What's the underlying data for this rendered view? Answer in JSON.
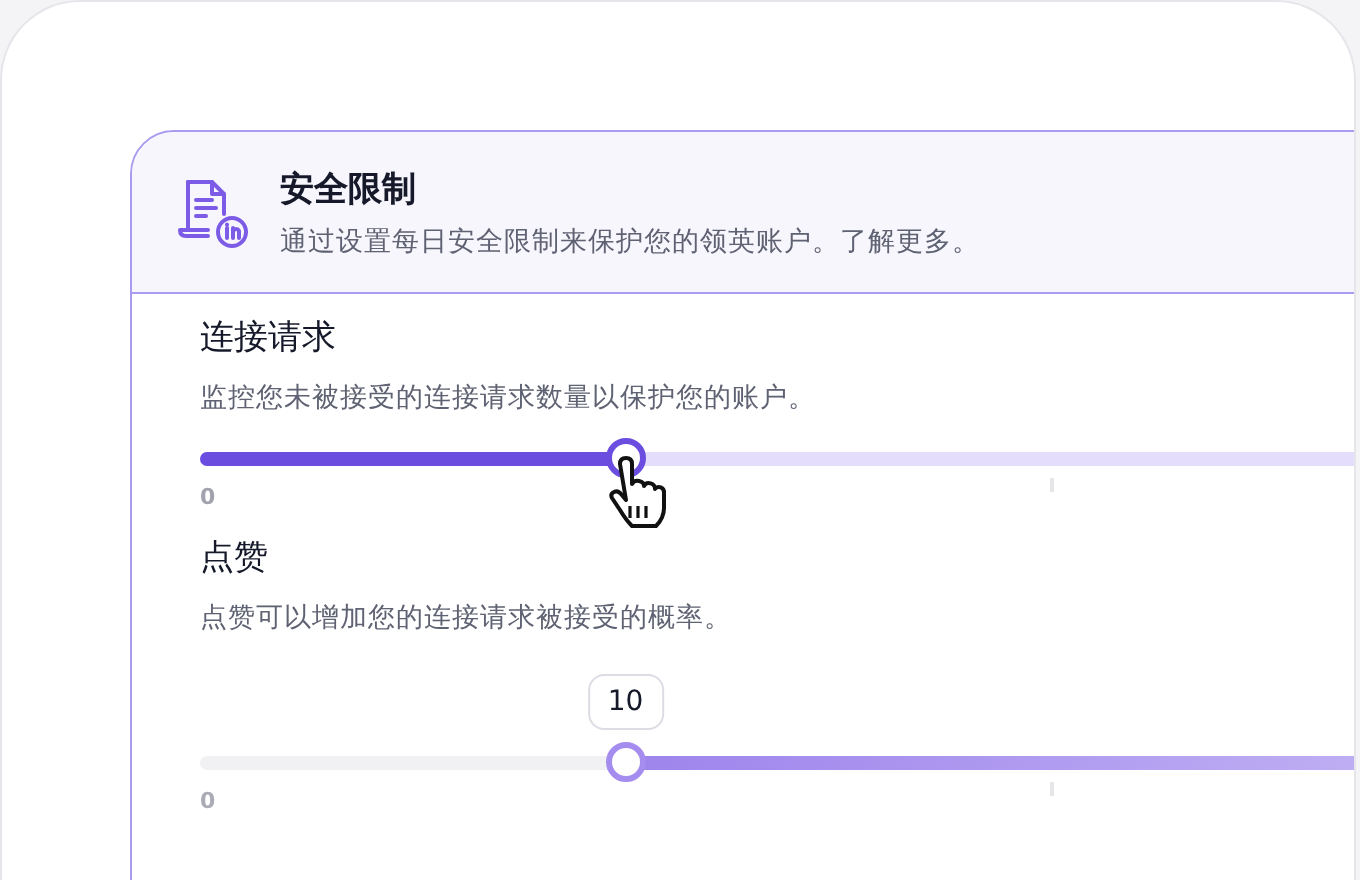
{
  "header": {
    "title": "安全限制",
    "subtitle": "通过设置每日安全限制来保护您的领英账户。了解更多。"
  },
  "settings": [
    {
      "title": "连接请求",
      "description": "监控您未被接受的连接请求数量以保护您的账户。",
      "kind": "active",
      "level": 0.334,
      "min_label": "0"
    },
    {
      "title": "点赞",
      "description": "点赞可以增加您的连接请求被接受的概率。",
      "kind": "inverted",
      "min_label": "0",
      "value_tooltip": "10"
    }
  ]
}
